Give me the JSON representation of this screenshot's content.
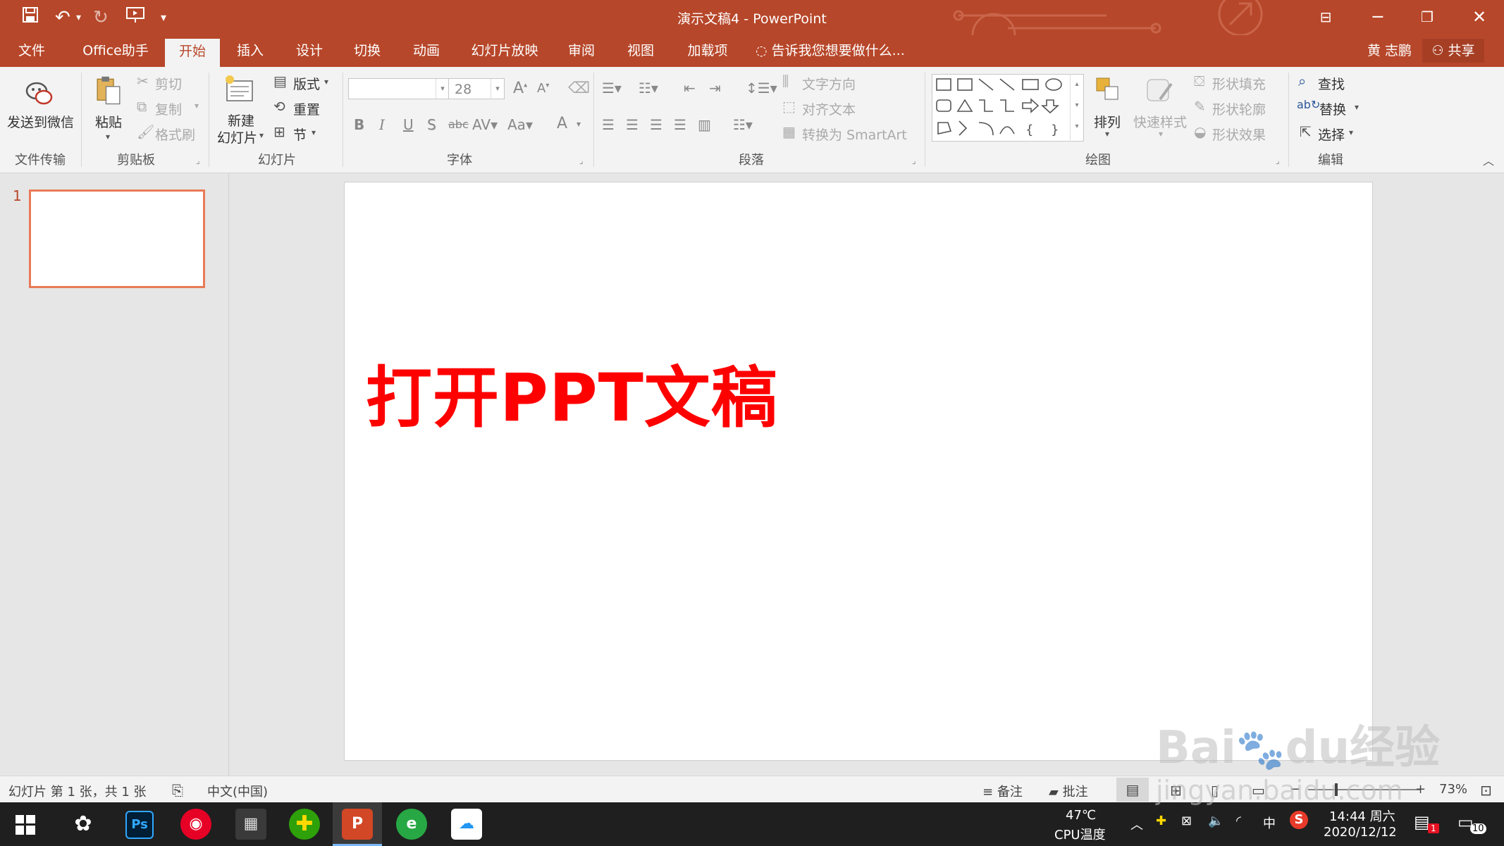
{
  "window": {
    "title": "演示文稿4 - PowerPoint"
  },
  "colors": {
    "accent": "#b7472a",
    "slide_text": "#ff0000",
    "thumb_border": "#e97a57"
  },
  "tabs": [
    {
      "label": "文件"
    },
    {
      "label": "Office助手"
    },
    {
      "label": "开始"
    },
    {
      "label": "插入"
    },
    {
      "label": "设计"
    },
    {
      "label": "切换"
    },
    {
      "label": "动画"
    },
    {
      "label": "幻灯片放映"
    },
    {
      "label": "审阅"
    },
    {
      "label": "视图"
    },
    {
      "label": "加载项"
    }
  ],
  "tell_me": "告诉我您想要做什么...",
  "user": {
    "name": "黄 志鹏",
    "share": "共享"
  },
  "ribbon": {
    "file_transfer": {
      "send_wechat": "发送到微信",
      "group": "文件传输"
    },
    "clipboard": {
      "paste": "粘贴",
      "cut": "剪切",
      "copy": "复制",
      "format_painter": "格式刷",
      "group": "剪贴板"
    },
    "slides": {
      "new_slide_1": "新建",
      "new_slide_2": "幻灯片",
      "layout": "版式",
      "reset": "重置",
      "section": "节",
      "group": "幻灯片"
    },
    "font": {
      "font_name": "",
      "font_size": "28",
      "group": "字体"
    },
    "paragraph": {
      "text_direction": "文字方向",
      "align_text": "对齐文本",
      "smartart": "转换为 SmartArt",
      "group": "段落"
    },
    "drawing": {
      "arrange": "排列",
      "quick_styles": "快速样式",
      "fill": "形状填充",
      "outline": "形状轮廓",
      "effects": "形状效果",
      "group": "绘图"
    },
    "editing": {
      "find": "查找",
      "replace": "替换",
      "select": "选择",
      "group": "编辑"
    }
  },
  "thumbnail": {
    "number": "1"
  },
  "slide": {
    "text": "打开PPT文稿"
  },
  "status": {
    "slide_info": "幻灯片 第 1 张，共 1 张",
    "language": "中文(中国)",
    "notes": "备注",
    "comments": "批注",
    "zoom": "73%"
  },
  "taskbar": {
    "temp": "47℃",
    "cpu_label": "CPU温度",
    "ime": "中",
    "time": "14:44 周六",
    "date": "2020/12/12",
    "notif_badge": "1",
    "action_count": "10"
  },
  "watermark": {
    "brand": "Bai",
    "brand2": "du",
    "cn": "经验",
    "url": "jingyan.baidu.com"
  }
}
